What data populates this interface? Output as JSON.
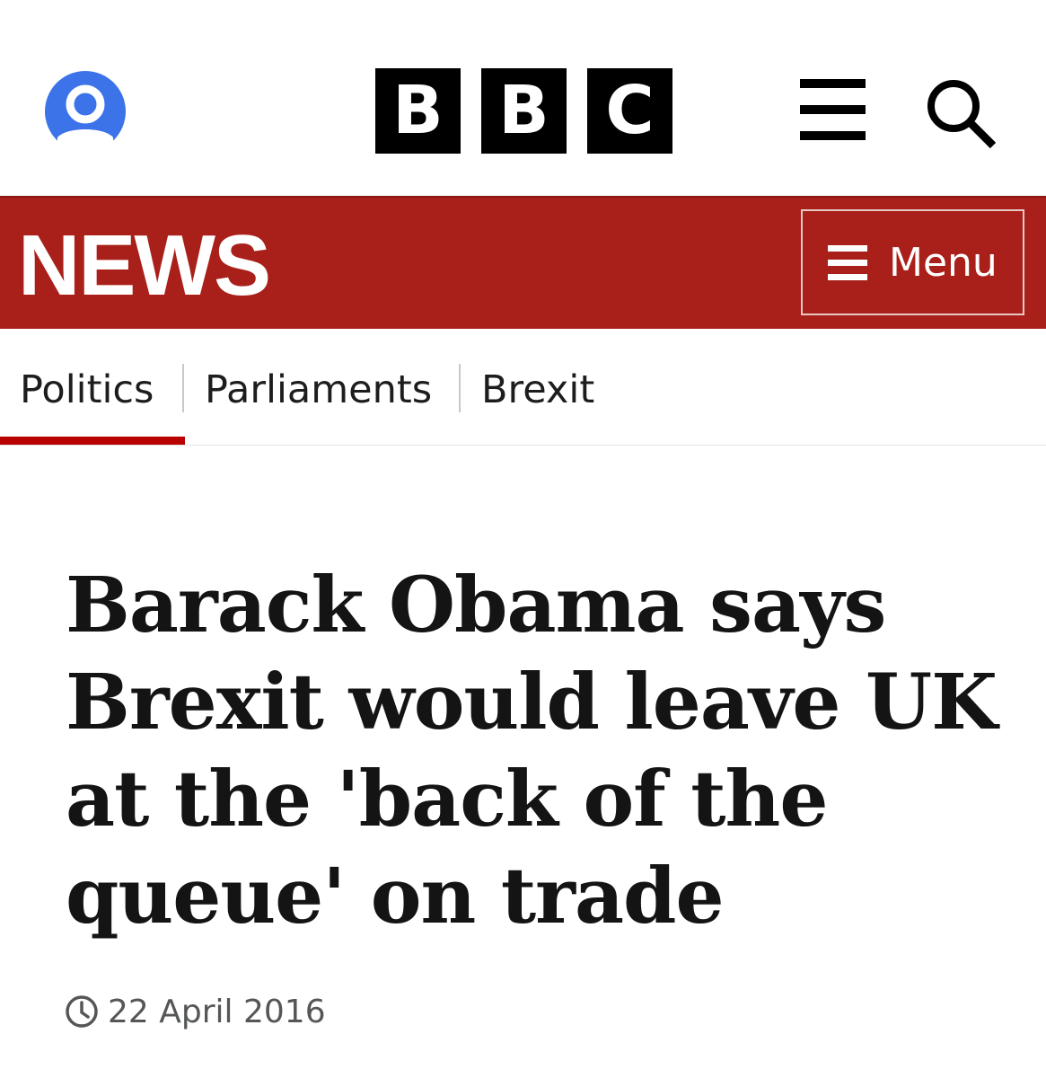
{
  "header": {
    "logo_letters": [
      "B",
      "B",
      "C"
    ],
    "account_icon": "user-account-icon",
    "nav_icon": "hamburger-menu-icon",
    "search_icon": "search-icon"
  },
  "news_bar": {
    "title": "NEWS",
    "menu_label": "Menu",
    "background_color": "#a9201a"
  },
  "breadcrumb": {
    "items": [
      {
        "label": "Politics",
        "active": true
      },
      {
        "label": "Parliaments",
        "active": false
      },
      {
        "label": "Brexit",
        "active": false
      }
    ]
  },
  "article": {
    "headline": "Barack Obama says Brexit would leave UK at the 'back of the queue' on trade",
    "date": "22 April 2016"
  },
  "colors": {
    "accent": "#b80000",
    "account_blue": "#3c73e8"
  }
}
